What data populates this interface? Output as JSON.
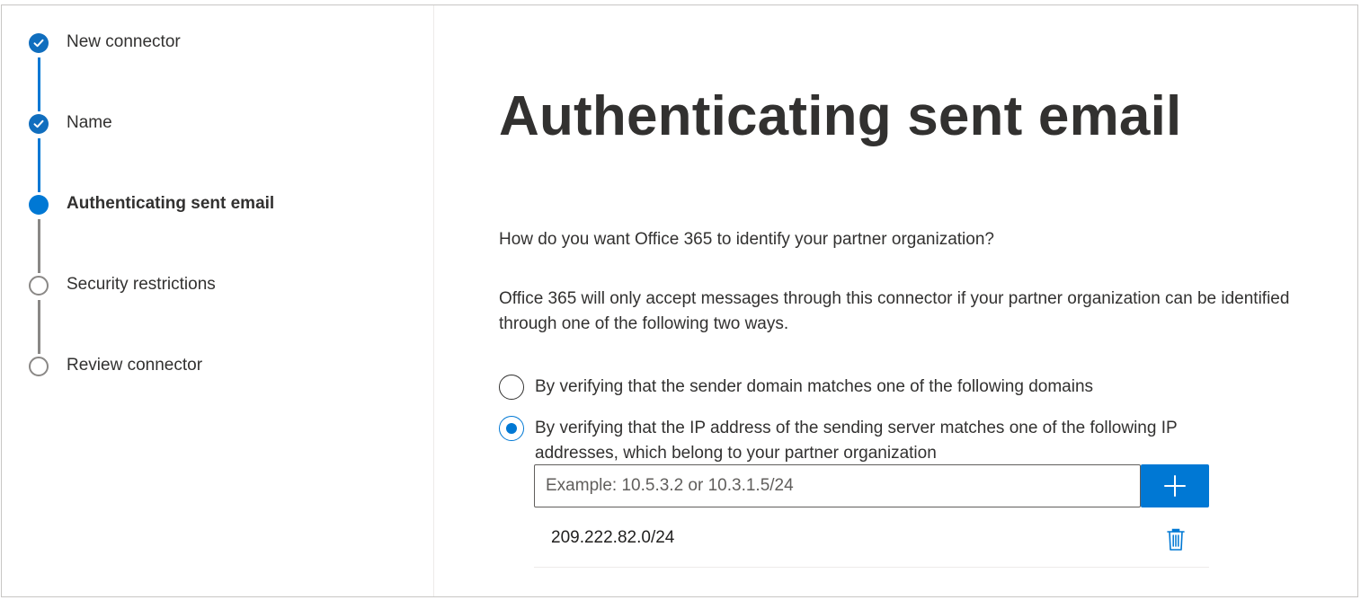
{
  "wizard": {
    "steps": [
      {
        "label": "New connector",
        "state": "done"
      },
      {
        "label": "Name",
        "state": "done"
      },
      {
        "label": "Authenticating sent email",
        "state": "current"
      },
      {
        "label": "Security restrictions",
        "state": "pending"
      },
      {
        "label": "Review connector",
        "state": "pending"
      }
    ]
  },
  "page": {
    "title": "Authenticating sent email",
    "question": "How do you want Office 365 to identify your partner organization?",
    "info": "Office 365 will only accept messages through this connector if your partner organization can be identified through one of the following two ways."
  },
  "options": {
    "domain": {
      "label": "By verifying that the sender domain matches one of the following domains",
      "checked": false
    },
    "ip": {
      "label": "By verifying that the IP address of the sending server matches one of the following IP addresses, which belong to your partner organization",
      "checked": true
    }
  },
  "ip_entry": {
    "placeholder": "Example: 10.5.3.2 or 10.3.1.5/24",
    "value": "",
    "add_icon": "plus-icon"
  },
  "ip_list": [
    {
      "value": "209.222.82.0/24",
      "delete_icon": "trash-icon"
    }
  ],
  "colors": {
    "accent": "#0078d4",
    "pending": "#8a8886",
    "text": "#323130"
  }
}
